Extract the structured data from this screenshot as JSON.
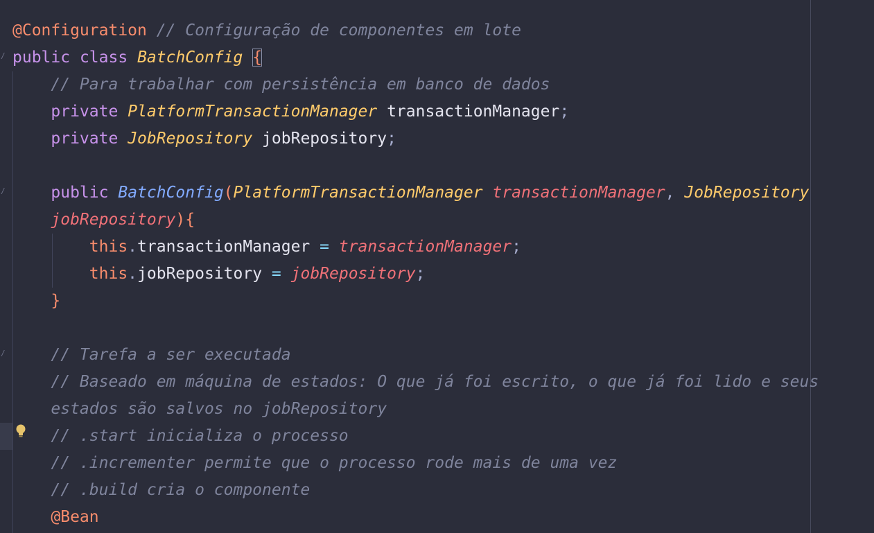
{
  "editor": {
    "language": "java",
    "colors": {
      "background": "#2b2d3a",
      "keyword": "#c792ea",
      "annotation": "#f78c6c",
      "type": "#ffcb6b",
      "method": "#82aaff",
      "parameter": "#f07178",
      "comment": "#7f849c",
      "identifier": "#e4e4ef"
    },
    "gutter_icons": [
      "intention-bulb-icon"
    ],
    "lines": [
      [
        [
          "ann",
          "@Configuration"
        ],
        [
          "id",
          " "
        ],
        [
          "cm",
          "// Configuração de componentes em lote"
        ]
      ],
      [
        [
          "kw",
          "public"
        ],
        [
          "id",
          " "
        ],
        [
          "kw",
          "class"
        ],
        [
          "id",
          " "
        ],
        [
          "cls",
          "BatchConfig"
        ],
        [
          "id",
          " "
        ],
        [
          "brhl",
          "{"
        ]
      ],
      [
        [
          "id",
          "    "
        ],
        [
          "cm",
          "// Para trabalhar com persistência em banco de dados"
        ]
      ],
      [
        [
          "id",
          "    "
        ],
        [
          "kw",
          "private"
        ],
        [
          "id",
          " "
        ],
        [
          "cls",
          "PlatformTransactionManager"
        ],
        [
          "id",
          " transactionManager"
        ],
        [
          "punc",
          ";"
        ]
      ],
      [
        [
          "id",
          "    "
        ],
        [
          "kw",
          "private"
        ],
        [
          "id",
          " "
        ],
        [
          "cls",
          "JobRepository"
        ],
        [
          "id",
          " jobRepository"
        ],
        [
          "punc",
          ";"
        ]
      ],
      [
        [
          "id",
          ""
        ]
      ],
      [
        [
          "id",
          "    "
        ],
        [
          "kw",
          "public"
        ],
        [
          "id",
          " "
        ],
        [
          "fn",
          "BatchConfig"
        ],
        [
          "br",
          "("
        ],
        [
          "cls",
          "PlatformTransactionManager"
        ],
        [
          "id",
          " "
        ],
        [
          "par",
          "transactionManager"
        ],
        [
          "punc",
          ", "
        ],
        [
          "cls",
          "JobRepository"
        ]
      ],
      [
        [
          "id",
          "    "
        ],
        [
          "par",
          "jobRepository"
        ],
        [
          "br",
          "){"
        ]
      ],
      [
        [
          "id",
          "        "
        ],
        [
          "this",
          "this"
        ],
        [
          "punc",
          "."
        ],
        [
          "id",
          "transactionManager "
        ],
        [
          "op",
          "="
        ],
        [
          "id",
          " "
        ],
        [
          "par",
          "transactionManager"
        ],
        [
          "punc",
          ";"
        ]
      ],
      [
        [
          "id",
          "        "
        ],
        [
          "this",
          "this"
        ],
        [
          "punc",
          "."
        ],
        [
          "id",
          "jobRepository "
        ],
        [
          "op",
          "="
        ],
        [
          "id",
          " "
        ],
        [
          "par",
          "jobRepository"
        ],
        [
          "punc",
          ";"
        ]
      ],
      [
        [
          "id",
          "    "
        ],
        [
          "br",
          "}"
        ]
      ],
      [
        [
          "id",
          ""
        ]
      ],
      [
        [
          "id",
          "    "
        ],
        [
          "cm",
          "// Tarefa a ser executada"
        ]
      ],
      [
        [
          "id",
          "    "
        ],
        [
          "cm",
          "// Baseado em máquina de estados: O que já foi escrito, o que já foi lido e seus"
        ]
      ],
      [
        [
          "id",
          "    "
        ],
        [
          "cm",
          "estados são salvos no jobRepository"
        ]
      ],
      [
        [
          "id",
          "    "
        ],
        [
          "cm",
          "// .start inicializa o processo"
        ]
      ],
      [
        [
          "id",
          "    "
        ],
        [
          "cm",
          "// .incrementer permite que o processo rode mais de uma vez"
        ]
      ],
      [
        [
          "id",
          "    "
        ],
        [
          "cm",
          "// .build cria o componente"
        ]
      ],
      [
        [
          "id",
          "    "
        ],
        [
          "ann",
          "@Bean"
        ]
      ]
    ]
  }
}
